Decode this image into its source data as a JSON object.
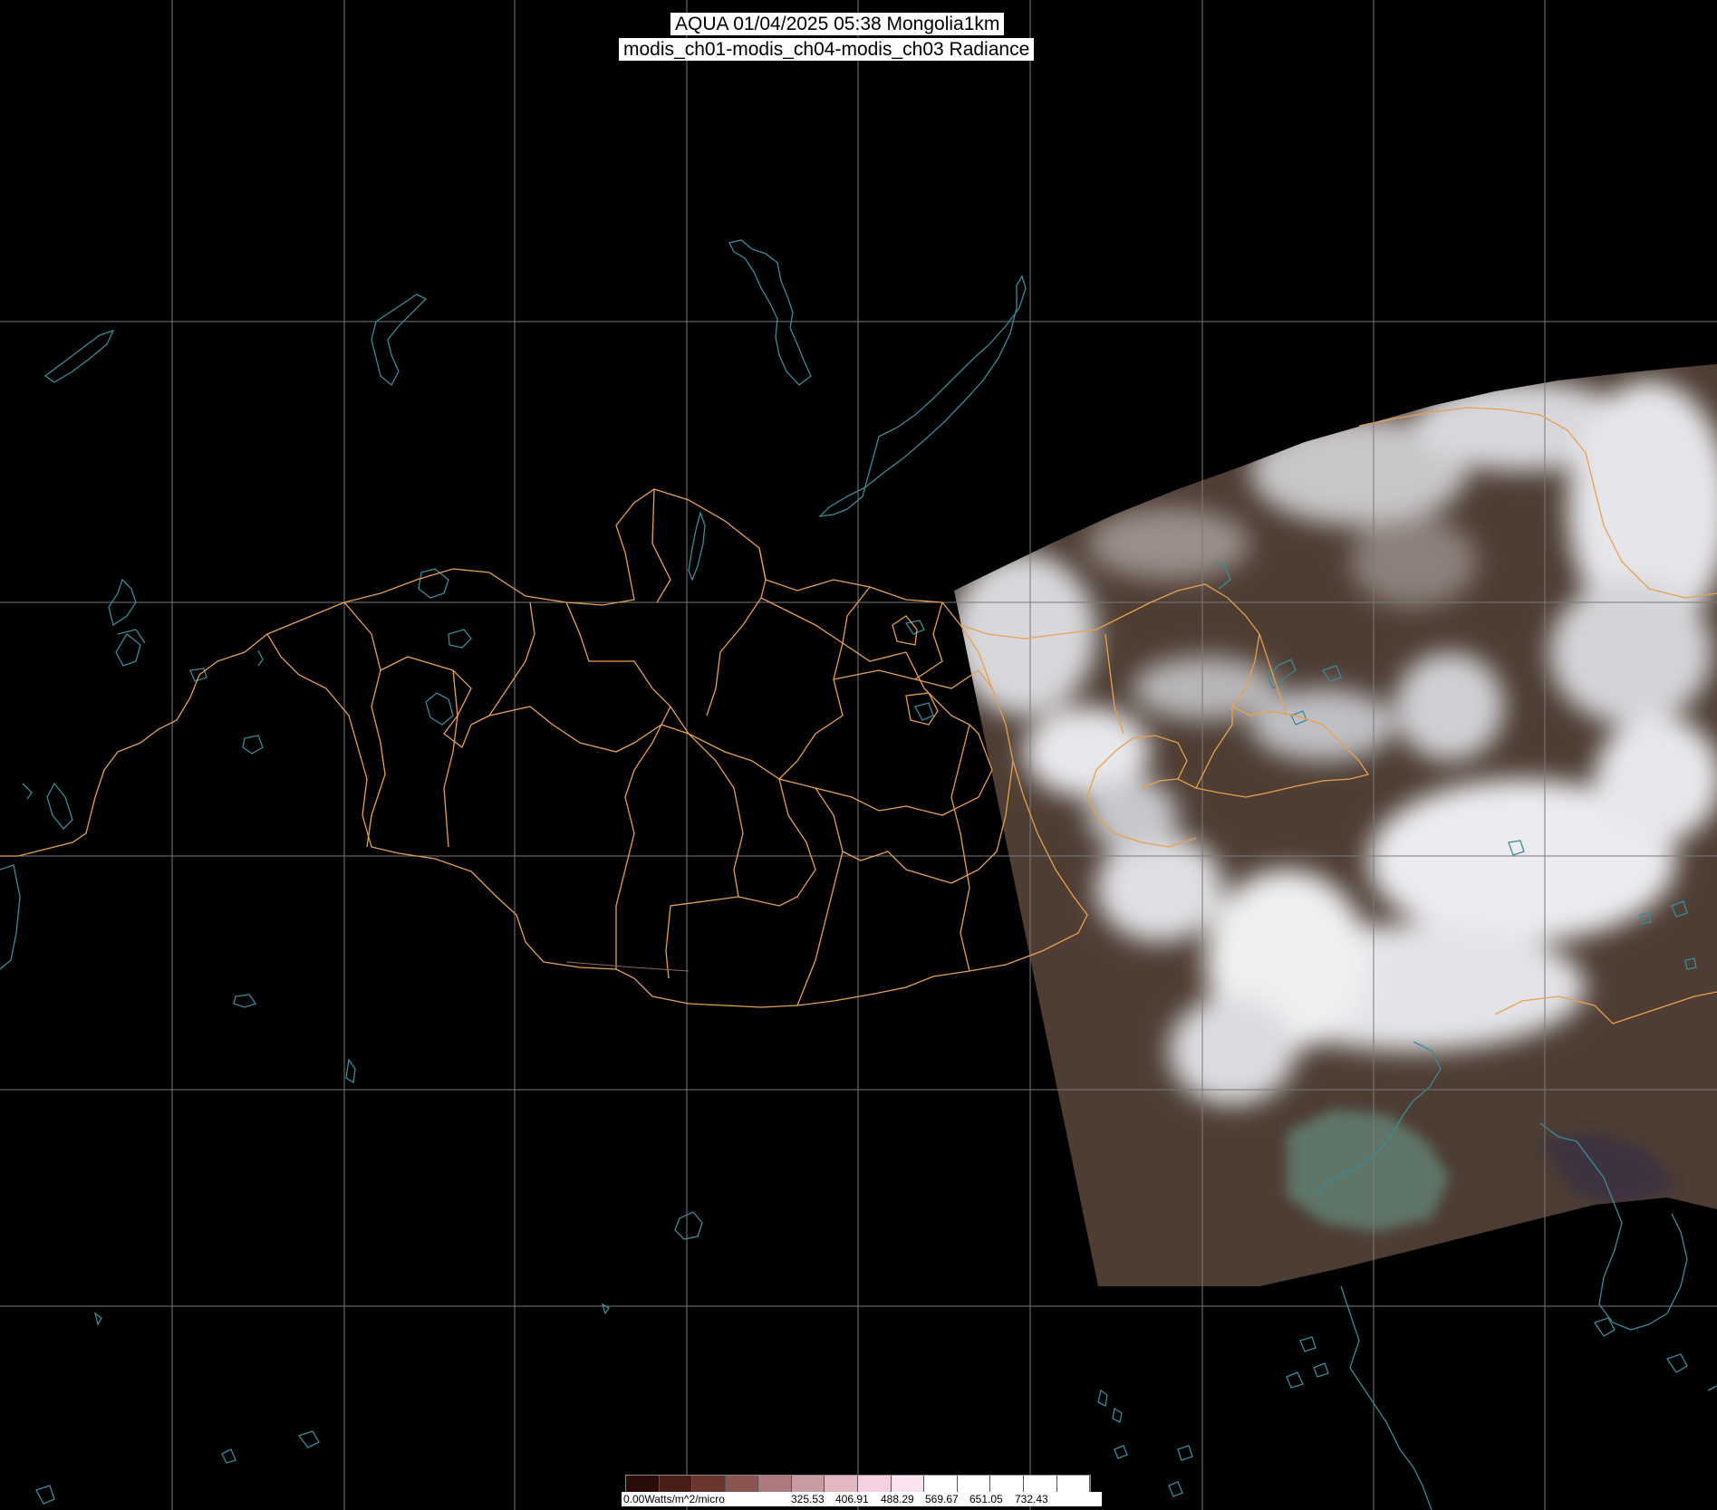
{
  "title": {
    "line1": "AQUA 01/04/2025 05:38 Mongolia1km",
    "line2": "modis_ch01-modis_ch04-modis_ch03 Radiance"
  },
  "colorbar": {
    "swatches": [
      "#2a0c08",
      "#4a1e18",
      "#6b3630",
      "#8b5552",
      "#ac7a7c",
      "#c89aa2",
      "#e4b6c2",
      "#f6cfe0",
      "#fbe2f0",
      "#ffffff",
      "#ffffff",
      "#ffffff",
      "#ffffff",
      "#ffffff"
    ],
    "unit_label": "0.00Watts/m^2/micro",
    "tick_labels": [
      "325.53",
      "406.91",
      "488.29",
      "569.67",
      "651.05",
      "732.43"
    ]
  },
  "colors": {
    "background": "#000000",
    "graticule": "#7a7a7a",
    "border": "#e8a050",
    "water": "#3a8a9a",
    "cloud": "#ffffff",
    "land": "#5a4538"
  }
}
